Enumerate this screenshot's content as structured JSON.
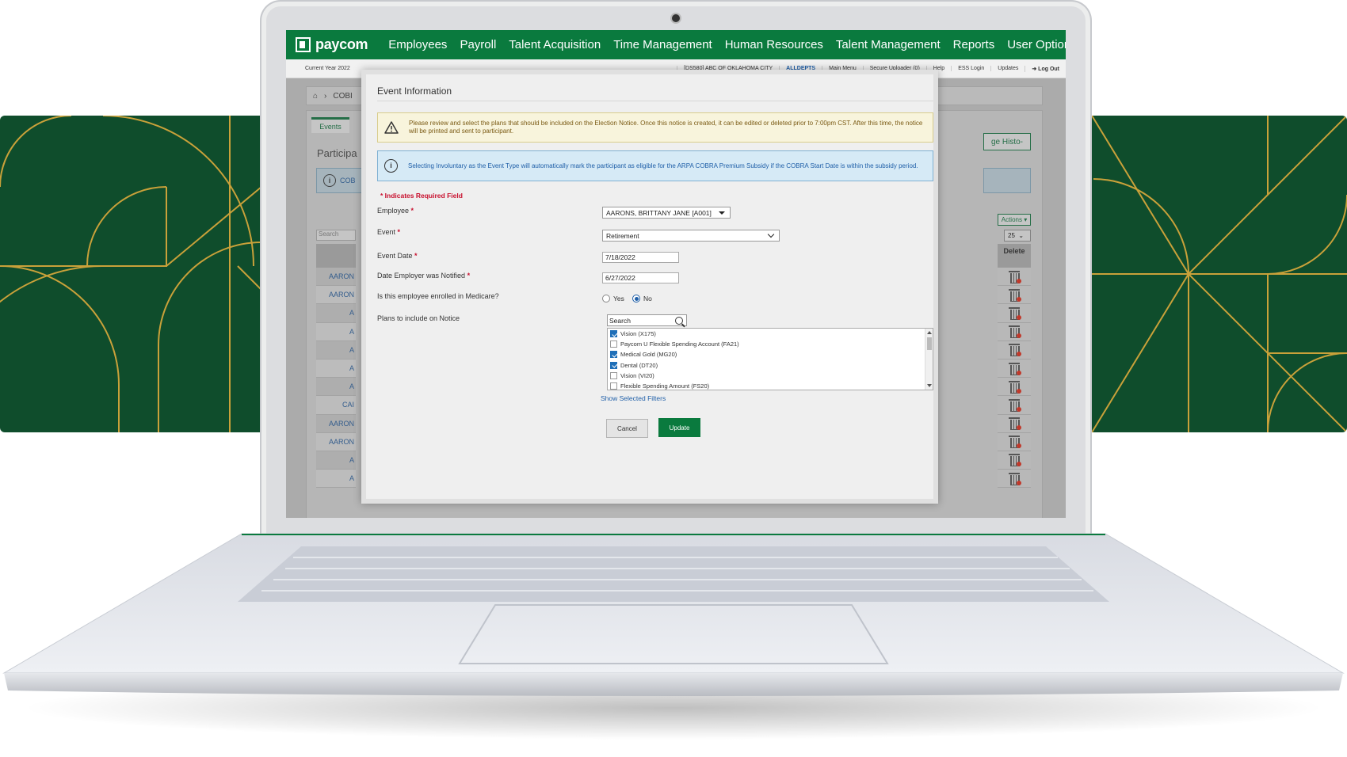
{
  "app": {
    "brand": "paycom",
    "accent": "#0a7a3e",
    "deco_bg": "#0f4d2c",
    "deco_line": "#c9a13a"
  },
  "nav": {
    "items": [
      "Employees",
      "Payroll",
      "Talent Acquisition",
      "Time Management",
      "Human Resources",
      "Talent Management",
      "Reports",
      "User Options"
    ]
  },
  "subbar": {
    "current_year": "Current Year 2022",
    "company": "[DS580] ABC OF OKLAHOMA CITY",
    "depts": "ALLDEPTS",
    "links": [
      "Main Menu",
      "Secure Uploader (0)",
      "Help",
      "ESS Login",
      "Updates"
    ],
    "logout": "Log Out"
  },
  "background": {
    "breadcrumb": "COBI",
    "tab_events": "Events",
    "participants_title": "Participa",
    "info_text": "COB",
    "change_history": "ge Histo-",
    "search_placeholder": "Search",
    "actions": "Actions",
    "page_size": "25",
    "delete_header": "Delete",
    "rows": [
      "AARON",
      "AARON",
      "A",
      "A",
      "A",
      "A",
      "A",
      "CAI",
      "AARON",
      "AARON",
      "A",
      "A"
    ]
  },
  "modal": {
    "title": "Event Information",
    "warning": "Please review and select the plans that should be included on the Election Notice. Once this notice is created, it can be edited or deleted prior to 7:00pm CST. After this time, the notice will be printed and sent to participant.",
    "note": "Selecting Involuntary as the Event Type will automatically mark the participant as eligible for the ARPA COBRA Premium Subsidy if the COBRA Start Date is within the subsidy period.",
    "required_note": "* Indicates Required Field",
    "fields": {
      "employee_label": "Employee",
      "employee_value": "AARONS, BRITTANY JANE [A001]",
      "event_label": "Event",
      "event_value": "Retirement",
      "event_date_label": "Event Date",
      "event_date_value": "7/18/2022",
      "notified_label": "Date Employer was Notified",
      "notified_value": "6/27/2022",
      "medicare_label": "Is this employee enrolled in Medicare?",
      "medicare_yes": "Yes",
      "medicare_no": "No",
      "plans_label": "Plans to include on Notice"
    },
    "plan_search_placeholder": "Search",
    "plans": [
      {
        "name": "Vision (X175)",
        "checked": true
      },
      {
        "name": "Paycom U Flexible Spending Account (FA21)",
        "checked": false
      },
      {
        "name": "Medical Gold (MG20)",
        "checked": true
      },
      {
        "name": "Dental (DT20)",
        "checked": true
      },
      {
        "name": "Vision (VI20)",
        "checked": false
      },
      {
        "name": "Flexible Spending Amount (FS20)",
        "checked": false
      }
    ],
    "show_selected": "Show Selected Filters",
    "cancel": "Cancel",
    "update": "Update"
  }
}
